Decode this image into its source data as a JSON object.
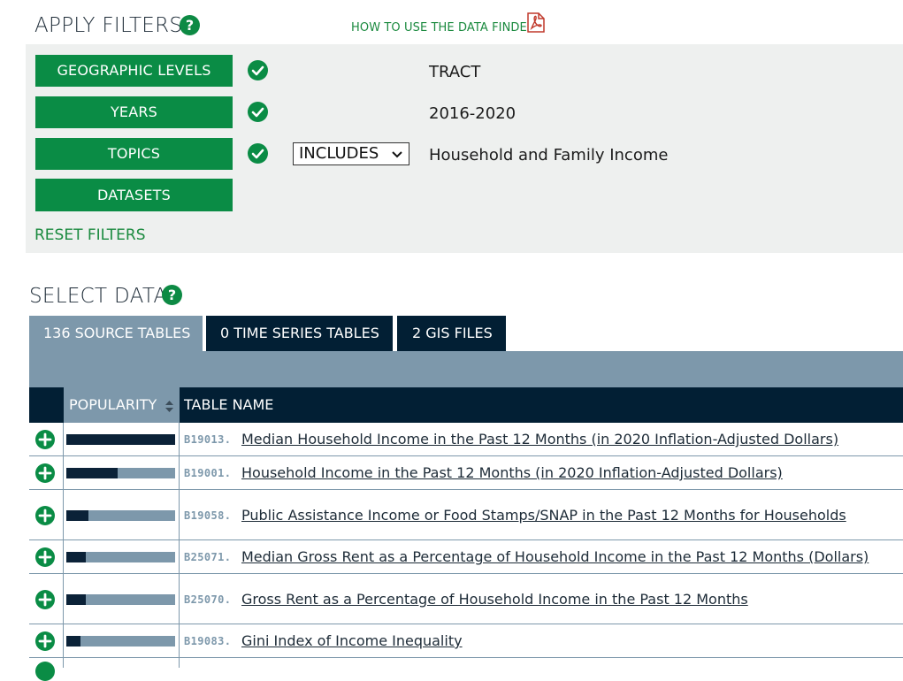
{
  "filters": {
    "heading": "APPLY FILTERS",
    "help_glyph": "?",
    "how_to": "HOW TO USE THE DATA FINDER",
    "rows": [
      {
        "button": "GEOGRAPHIC LEVELS",
        "selected": true,
        "value": "TRACT"
      },
      {
        "button": "YEARS",
        "selected": true,
        "value": "2016-2020"
      },
      {
        "button": "TOPICS",
        "selected": true,
        "value": "Household and Family Income",
        "select": "INCLUDES"
      },
      {
        "button": "DATASETS",
        "selected": false,
        "value": ""
      }
    ],
    "reset": "RESET FILTERS"
  },
  "select_data": {
    "heading": "SELECT DATA",
    "help_glyph": "?",
    "tabs": [
      {
        "label": "136 SOURCE TABLES",
        "active": true
      },
      {
        "label": "0 TIME SERIES TABLES",
        "active": false
      },
      {
        "label": "2 GIS FILES",
        "active": false
      }
    ],
    "columns": {
      "popularity": "POPULARITY",
      "table_name": "TABLE NAME"
    },
    "rows": [
      {
        "code": "B19013.",
        "name": "Median Household Income in the Past 12 Months (in 2020 Inflation-Adjusted Dollars)",
        "popularity": 1.0
      },
      {
        "code": "B19001.",
        "name": "Household Income in the Past 12 Months (in 2020 Inflation-Adjusted Dollars)",
        "popularity": 0.47
      },
      {
        "code": "B19058.",
        "name": "Public Assistance Income or Food Stamps/SNAP in the Past 12 Months for Households",
        "popularity": 0.2
      },
      {
        "code": "B25071.",
        "name": "Median Gross Rent as a Percentage of Household Income in the Past 12 Months (Dollars)",
        "popularity": 0.18
      },
      {
        "code": "B25070.",
        "name": "Gross Rent as a Percentage of Household Income in the Past 12 Months",
        "popularity": 0.18
      },
      {
        "code": "B19083.",
        "name": "Gini Index of Income Inequality",
        "popularity": 0.13
      }
    ]
  },
  "colors": {
    "green": "#0a8c45",
    "navy": "#021f34",
    "steel": "#7d98ab",
    "panel": "#eef0ef"
  }
}
